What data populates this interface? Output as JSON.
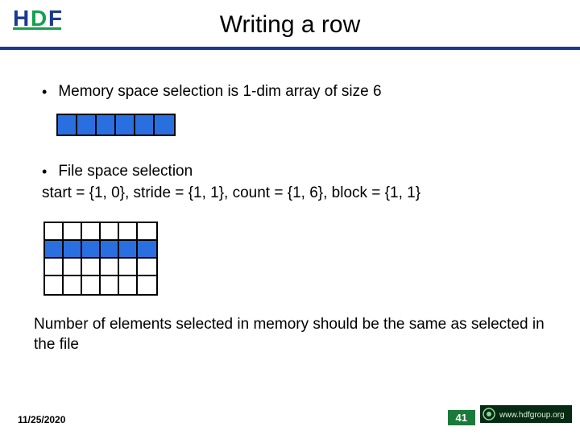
{
  "header": {
    "title": "Writing a row"
  },
  "bullets": {
    "b1": "Memory space selection is 1-dim array of size 6",
    "b2": "File space selection",
    "params": "start = {1, 0}, stride = {1, 1}, count = {1, 6}, block = {1, 1}"
  },
  "note": "Number of elements selected in memory should be the same as selected in the file",
  "footer": {
    "date": "11/25/2020",
    "page": "41",
    "org": "www.hdfgroup.org"
  },
  "memory_array": {
    "size": 6
  },
  "file_grid": {
    "rows": 4,
    "cols": 6,
    "selected_row_index": 1
  },
  "colors": {
    "accent_blue": "#2a6fe0",
    "rule": "#1a3a8f",
    "badge_green": "#1a7a3a"
  }
}
